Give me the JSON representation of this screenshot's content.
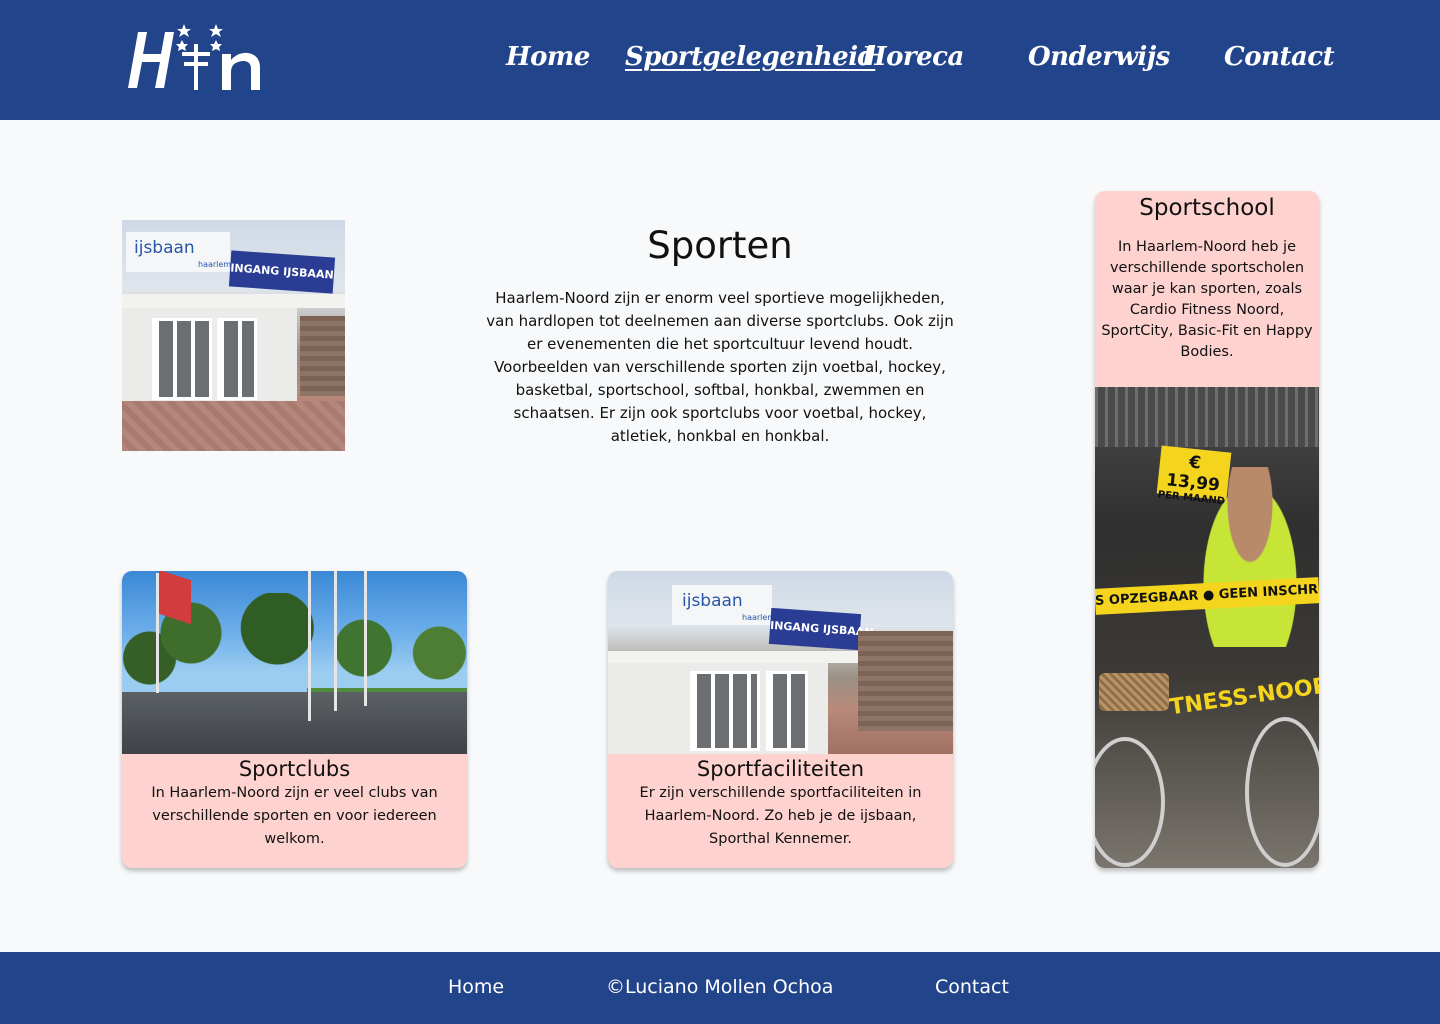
{
  "header": {
    "logo_text": "H+n",
    "nav": [
      {
        "label": "Home",
        "active": false
      },
      {
        "label": "Sportgelegenheid",
        "active": true
      },
      {
        "label": "Horeca",
        "active": false
      },
      {
        "label": "Onderwijs",
        "active": false
      },
      {
        "label": "Contact",
        "active": false
      }
    ]
  },
  "intro": {
    "photo_sign_left": "ijsbaan",
    "photo_sign_left_sub": "haarlem",
    "photo_sign_right": "INGANG IJSBAAN",
    "title": "Sporten",
    "text": "Haarlem-Noord zijn er enorm veel sportieve mogelijkheden, van hardlopen tot deelnemen aan diverse sportclubs. Ook zijn er evenementen die het sportcultuur levend houdt. Voorbeelden van verschillende sporten zijn voetbal, hockey, basketbal, sportschool, softbal, honkbal, zwemmen en schaatsen. Er zijn ook sportclubs voor voetbal, hockey, atletiek, honkbal en honkbal."
  },
  "cards": {
    "sportclubs": {
      "title": "Sportclubs",
      "text": "In Haarlem-Noord zijn er veel clubs van verschillende sporten en voor iedereen welkom."
    },
    "sportfaciliteiten": {
      "title": "Sportfaciliteiten",
      "text": "Er zijn verschillende sportfaciliteiten in Haarlem-Noord. Zo heb je de ijsbaan, Sporthal Kennemer.",
      "photo_sign_left": "ijsbaan",
      "photo_sign_left_sub": "haarlem",
      "photo_sign_right": "INGANG IJSBAAN"
    },
    "sportschool": {
      "title": "Sportschool",
      "text": "In Haarlem-Noord heb je verschillende sportscholen waar je kan sporten, zoals Cardio Fitness Noord, SportCity, Basic-Fit en Happy Bodies.",
      "photo_price": "€ 13,99",
      "photo_price_sub": "PER MAAND",
      "photo_tape": "S OPZEGBAAR  ● GEEN INSCHRIJFGE",
      "photo_banner": "TNESS-NOORD"
    }
  },
  "footer": {
    "home": "Home",
    "copyright": "©Luciano Mollen Ochoa",
    "contact": "Contact"
  },
  "colors": {
    "header_bg": "#22448b",
    "card_bg": "#fed2cf",
    "page_bg": "#f7f9fb"
  }
}
